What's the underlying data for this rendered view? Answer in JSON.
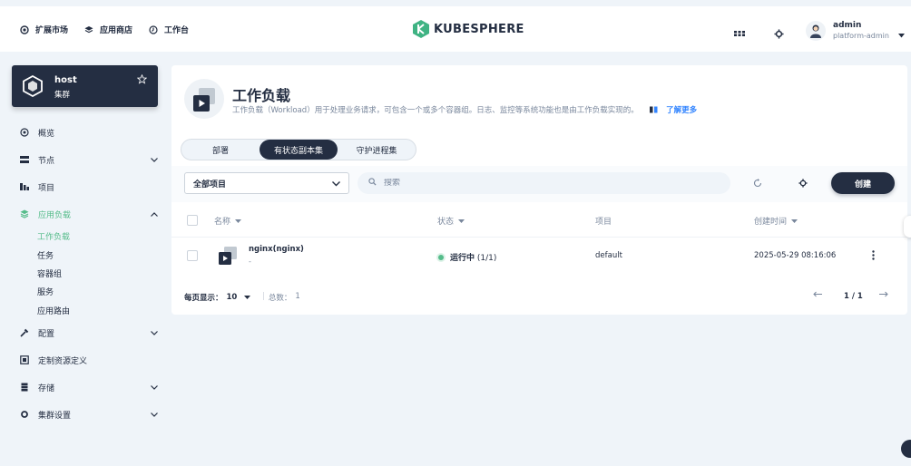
{
  "topnav": [
    {
      "label": "扩展市场",
      "icon": "puzzle-icon"
    },
    {
      "label": "应用商店",
      "icon": "stack-icon"
    },
    {
      "label": "工作台",
      "icon": "workbench-icon"
    }
  ],
  "logo": {
    "text": "KUBESPHERE"
  },
  "user": {
    "name": "admin",
    "role": "platform-admin"
  },
  "cluster": {
    "name": "host",
    "type": "集群"
  },
  "sidebar": {
    "items": [
      {
        "label": "概览",
        "icon": "overview-icon"
      },
      {
        "label": "节点",
        "icon": "nodes-icon"
      },
      {
        "label": "项目",
        "icon": "projects-icon"
      },
      {
        "label": "应用负载",
        "icon": "app-workloads-icon"
      },
      {
        "label": "配置",
        "icon": "config-icon"
      },
      {
        "label": "定制资源定义",
        "icon": "crd-icon"
      },
      {
        "label": "存储",
        "icon": "storage-icon"
      },
      {
        "label": "集群设置",
        "icon": "cluster-settings-icon"
      }
    ],
    "subitems": [
      "工作负载",
      "任务",
      "容器组",
      "服务",
      "应用路由"
    ]
  },
  "page": {
    "title": "工作负载",
    "description": "工作负载（Workload）用于处理业务请求，可包含一个或多个容器组。日志、监控等系统功能也是由工作负载实现的。",
    "learn_more": "了解更多"
  },
  "tabs": [
    "部署",
    "有状态副本集",
    "守护进程集"
  ],
  "toolbar": {
    "project_select": "全部项目",
    "search_placeholder": "搜索",
    "create_label": "创建"
  },
  "table": {
    "headers": {
      "name": "名称",
      "status": "状态",
      "project": "项目",
      "created": "创建时间"
    },
    "rows": [
      {
        "name": "nginx(nginx)",
        "sub": "-",
        "status": "运行中",
        "count": "(1/1)",
        "project": "default",
        "created": "2025-05-29 08:16:06"
      }
    ]
  },
  "pagination": {
    "page_size_label": "每页显示：",
    "page_size": "10",
    "total_label": "总数：",
    "total": "1",
    "page_info": "1 / 1"
  },
  "colors": {
    "primary": "#242e42",
    "success": "#55bc8a",
    "link": "#3385ff",
    "background": "#eff4f9"
  }
}
